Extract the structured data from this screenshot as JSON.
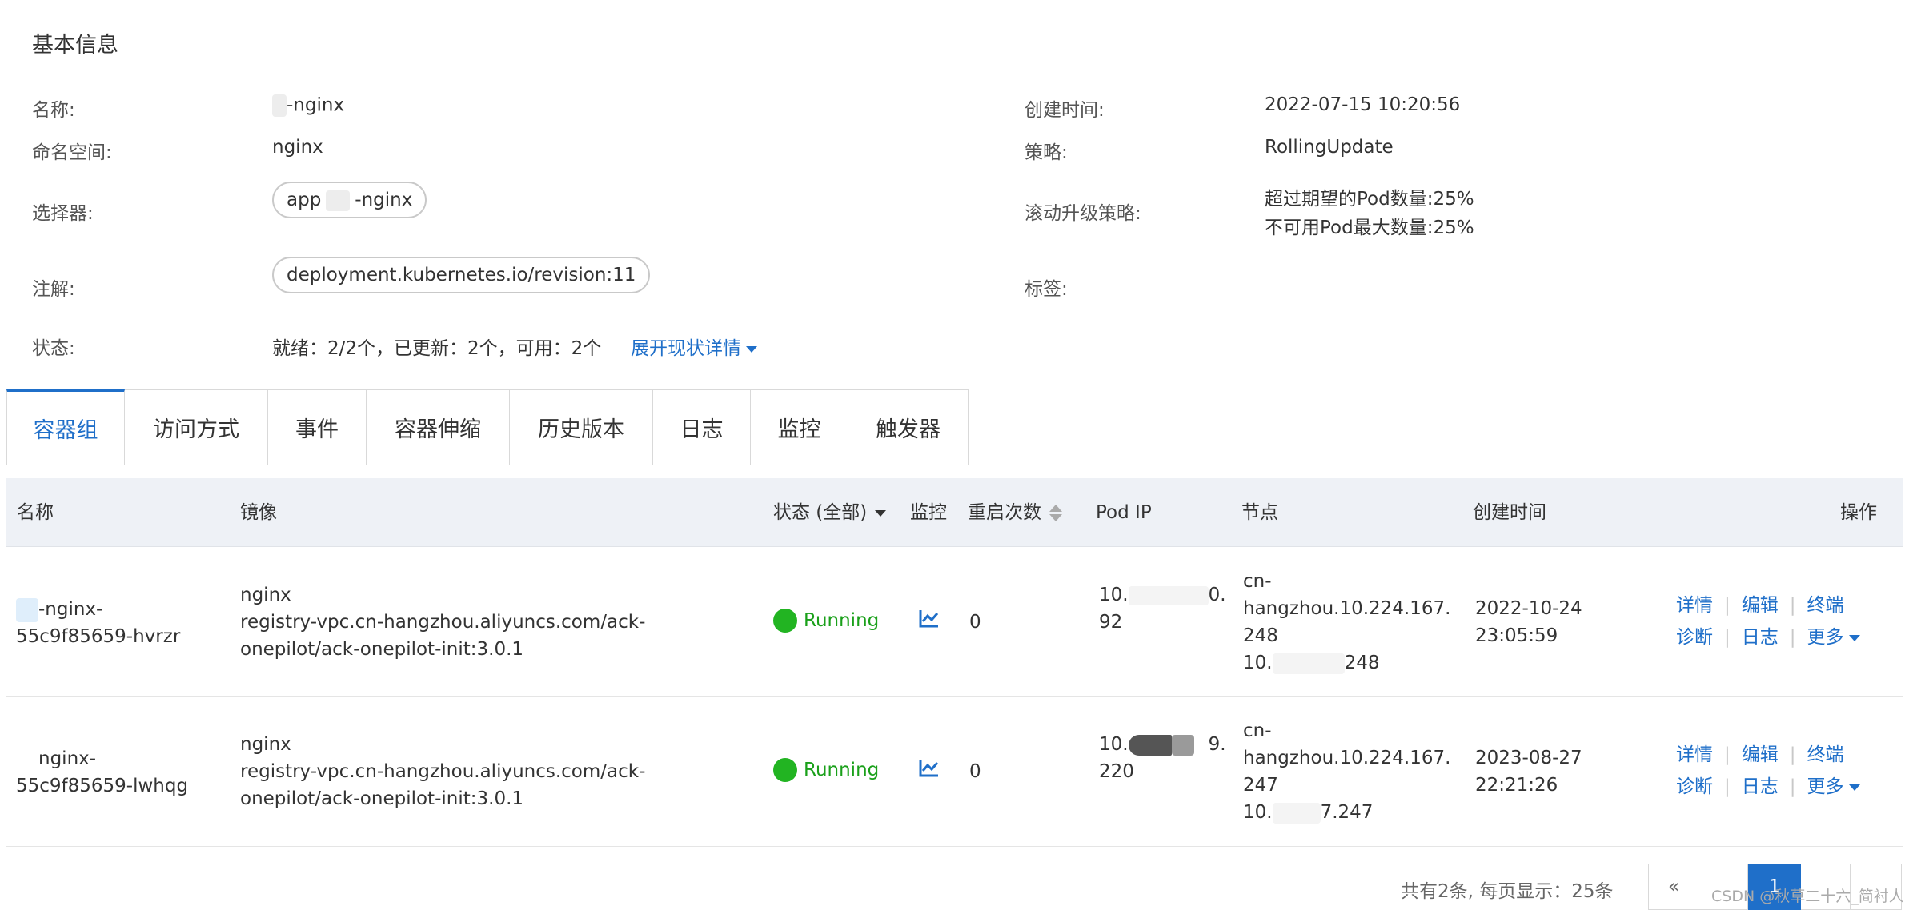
{
  "basic": {
    "title": "基本信息",
    "name_label": "名称:",
    "name_value": "-nginx",
    "namespace_label": "命名空间:",
    "namespace_value": "nginx",
    "selector_label": "选择器:",
    "selector_prefix": "app",
    "selector_suffix": "-nginx",
    "annotation_label": "注解:",
    "annotation_value": "deployment.kubernetes.io/revision:11",
    "status_label": "状态:",
    "status_value": "就绪：2/2个，已更新：2个，可用：2个",
    "status_expand": "展开现状详情",
    "created_label": "创建时间:",
    "created_value": "2022-07-15 10:20:56",
    "strategy_label": "策略:",
    "strategy_value": "RollingUpdate",
    "rolling_label": "滚动升级策略:",
    "rolling_line1": "超过期望的Pod数量:25%",
    "rolling_line2": "不可用Pod最大数量:25%",
    "tags_label": "标签:"
  },
  "tabs": [
    {
      "label": "容器组",
      "active": true
    },
    {
      "label": "访问方式"
    },
    {
      "label": "事件"
    },
    {
      "label": "容器伸缩"
    },
    {
      "label": "历史版本"
    },
    {
      "label": "日志"
    },
    {
      "label": "监控"
    },
    {
      "label": "触发器"
    }
  ],
  "table": {
    "headers": {
      "name": "名称",
      "image": "镜像",
      "status": "状态 (全部)",
      "monitor": "监控",
      "restarts": "重启次数",
      "pod_ip": "Pod IP",
      "node": "节点",
      "created": "创建时间",
      "actions": "操作"
    },
    "rows": [
      {
        "name_line1": "-nginx-",
        "name_line2": "55c9f85659-hvrzr",
        "image_line1": "nginx",
        "image_line2": "registry-vpc.cn-hangzhou.aliyuncs.com/ack-",
        "image_line3": "onepilot/ack-onepilot-init:3.0.1",
        "status": "Running",
        "restarts": "0",
        "ip_line1a": "10.",
        "ip_line1b": "0.",
        "ip_line2": "92",
        "node_line1": "cn-",
        "node_line2": "hangzhou.10.224.167.",
        "node_line3": "248",
        "node_line4a": "10.",
        "node_line4b": "248",
        "created_line1": "2022-10-24",
        "created_line2": "23:05:59"
      },
      {
        "name_line1": "nginx-",
        "name_line2": "55c9f85659-lwhqg",
        "image_line1": "nginx",
        "image_line2": "registry-vpc.cn-hangzhou.aliyuncs.com/ack-",
        "image_line3": "onepilot/ack-onepilot-init:3.0.1",
        "status": "Running",
        "restarts": "0",
        "ip_line1a": "10.",
        "ip_line1b": "9.",
        "ip_line2": "220",
        "node_line1": "cn-",
        "node_line2": "hangzhou.10.224.167.",
        "node_line3": "247",
        "node_line4a": "10.",
        "node_line4b": "7.247",
        "created_line1": "2023-08-27",
        "created_line2": "22:21:26"
      }
    ],
    "actions": {
      "detail": "详情",
      "edit": "编辑",
      "terminal": "终端",
      "diagnose": "诊断",
      "logs": "日志",
      "more": "更多"
    }
  },
  "pager": {
    "summary": "共有2条, 每页显示：25条",
    "prev": "«",
    "current": "1"
  },
  "watermark": "CSDN @秋草二十六_简衬人",
  "colors": {
    "link": "#1f6fc9",
    "running": "#22b422",
    "header_bg": "#eef1f6"
  }
}
